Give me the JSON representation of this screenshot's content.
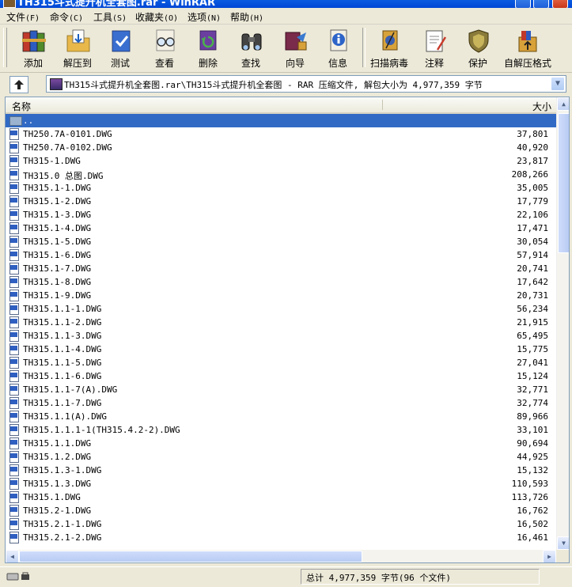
{
  "window": {
    "title": "TH315斗式提升机全套图.rar - WinRAR"
  },
  "menu": [
    {
      "label": "文件",
      "acc": "(F)"
    },
    {
      "label": "命令",
      "acc": "(C)"
    },
    {
      "label": "工具",
      "acc": "(S)"
    },
    {
      "label": "收藏夹",
      "acc": "(O)"
    },
    {
      "label": "选项",
      "acc": "(N)"
    },
    {
      "label": "帮助",
      "acc": "(H)"
    }
  ],
  "toolbar": {
    "add": "添加",
    "extract": "解压到",
    "test": "测试",
    "view": "查看",
    "delete": "删除",
    "find": "查找",
    "wizard": "向导",
    "info": "信息",
    "scan": "扫描病毒",
    "comment": "注释",
    "protect": "保护",
    "sfx": "自解压格式"
  },
  "icons": {
    "add": "books-stack-icon",
    "extract": "folder-extract-icon",
    "test": "checkmark-book-icon",
    "view": "glasses-icon",
    "delete": "recycle-delete-icon",
    "find": "binoculars-icon",
    "wizard": "wizard-icon",
    "info": "info-icon",
    "scan": "virus-scan-icon",
    "comment": "comment-notepad-icon",
    "protect": "shield-icon",
    "sfx": "sfx-box-icon"
  },
  "address": {
    "text": "TH315斗式提升机全套图.rar\\TH315斗式提升机全套图 - RAR 压缩文件, 解包大小为 4,977,359 字节"
  },
  "list": {
    "col_name": "名称",
    "col_size": "大小",
    "parent": "..",
    "files": [
      {
        "name": "TH250.7A-0101.DWG",
        "size": "37,801"
      },
      {
        "name": "TH250.7A-0102.DWG",
        "size": "40,920"
      },
      {
        "name": "TH315-1.DWG",
        "size": "23,817"
      },
      {
        "name": "TH315.0 总图.DWG",
        "size": "208,266"
      },
      {
        "name": "TH315.1-1.DWG",
        "size": "35,005"
      },
      {
        "name": "TH315.1-2.DWG",
        "size": "17,779"
      },
      {
        "name": "TH315.1-3.DWG",
        "size": "22,106"
      },
      {
        "name": "TH315.1-4.DWG",
        "size": "17,471"
      },
      {
        "name": "TH315.1-5.DWG",
        "size": "30,054"
      },
      {
        "name": "TH315.1-6.DWG",
        "size": "57,914"
      },
      {
        "name": "TH315.1-7.DWG",
        "size": "20,741"
      },
      {
        "name": "TH315.1-8.DWG",
        "size": "17,642"
      },
      {
        "name": "TH315.1-9.DWG",
        "size": "20,731"
      },
      {
        "name": "TH315.1.1-1.DWG",
        "size": "56,234"
      },
      {
        "name": "TH315.1.1-2.DWG",
        "size": "21,915"
      },
      {
        "name": "TH315.1.1-3.DWG",
        "size": "65,495"
      },
      {
        "name": "TH315.1.1-4.DWG",
        "size": "15,775"
      },
      {
        "name": "TH315.1.1-5.DWG",
        "size": "27,041"
      },
      {
        "name": "TH315.1.1-6.DWG",
        "size": "15,124"
      },
      {
        "name": "TH315.1.1-7(A).DWG",
        "size": "32,771"
      },
      {
        "name": "TH315.1.1-7.DWG",
        "size": "32,774"
      },
      {
        "name": "TH315.1.1(A).DWG",
        "size": "89,966"
      },
      {
        "name": "TH315.1.1.1-1(TH315.4.2-2).DWG",
        "size": "33,101"
      },
      {
        "name": "TH315.1.1.DWG",
        "size": "90,694"
      },
      {
        "name": "TH315.1.2.DWG",
        "size": "44,925"
      },
      {
        "name": "TH315.1.3-1.DWG",
        "size": "15,132"
      },
      {
        "name": "TH315.1.3.DWG",
        "size": "110,593"
      },
      {
        "name": "TH315.1.DWG",
        "size": "113,726"
      },
      {
        "name": "TH315.2-1.DWG",
        "size": "16,762"
      },
      {
        "name": "TH315.2.1-1.DWG",
        "size": "16,502"
      },
      {
        "name": "TH315.2.1-2.DWG",
        "size": "16,461"
      }
    ]
  },
  "status": {
    "text": "总计 4,977,359 字节(96 个文件)"
  }
}
